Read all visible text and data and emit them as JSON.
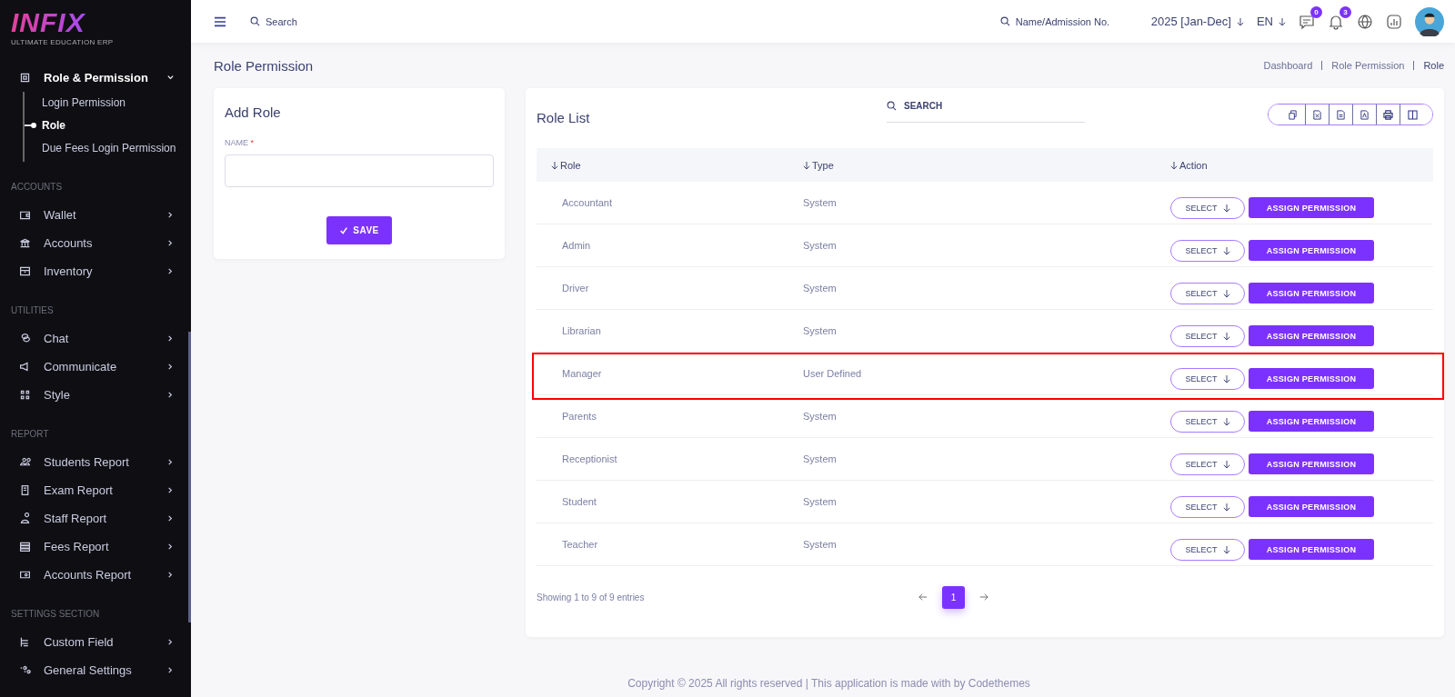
{
  "brand": {
    "logo": "INFIX",
    "tagline": "ULTIMATE EDUCATION ERP"
  },
  "sidebar": {
    "sections": [
      {
        "items": [
          {
            "label": "Role & Permission",
            "expanded": true,
            "children": [
              {
                "label": "Login Permission",
                "selected": false
              },
              {
                "label": "Role",
                "selected": true
              },
              {
                "label": "Due Fees Login Permission",
                "selected": false
              }
            ]
          }
        ]
      },
      {
        "heading": "ACCOUNTS",
        "items": [
          {
            "label": "Wallet",
            "expanded": false
          },
          {
            "label": "Accounts",
            "expanded": false
          },
          {
            "label": "Inventory",
            "expanded": false
          }
        ]
      },
      {
        "heading": "UTILITIES",
        "items": [
          {
            "label": "Chat",
            "expanded": false
          },
          {
            "label": "Communicate",
            "expanded": false
          },
          {
            "label": "Style",
            "expanded": false
          }
        ]
      },
      {
        "heading": "REPORT",
        "items": [
          {
            "label": "Students Report",
            "expanded": false
          },
          {
            "label": "Exam Report",
            "expanded": false
          },
          {
            "label": "Staff Report",
            "expanded": false
          },
          {
            "label": "Fees Report",
            "expanded": false
          },
          {
            "label": "Accounts Report",
            "expanded": false
          }
        ]
      },
      {
        "heading": "SETTINGS SECTION",
        "items": [
          {
            "label": "Custom Field",
            "expanded": false
          },
          {
            "label": "General Settings",
            "expanded": false
          }
        ]
      }
    ]
  },
  "header": {
    "search": {
      "placeholder": "Search"
    },
    "student_search": {
      "placeholder": "Name/Admission No."
    },
    "session": "2025 [Jan-Dec]",
    "language": "EN",
    "chat_count": "0",
    "notification_count": "3"
  },
  "page_title": "Role Permission",
  "breadcrumb": [
    "Dashboard",
    "Role Permission",
    "Role"
  ],
  "add_role": {
    "title": "Add Role",
    "field_label": "NAME",
    "required_mark": "*",
    "save": "SAVE"
  },
  "role_list": {
    "title": "Role List",
    "search": {
      "placeholder": "SEARCH"
    },
    "columns": [
      "Role",
      "Type",
      "Action"
    ],
    "rows": [
      {
        "role": "Accountant",
        "type": "System",
        "select": "SELECT",
        "assign": "ASSIGN PERMISSION",
        "highlighted": false
      },
      {
        "role": "Admin",
        "type": "System",
        "select": "SELECT",
        "assign": "ASSIGN PERMISSION",
        "highlighted": false
      },
      {
        "role": "Driver",
        "type": "System",
        "select": "SELECT",
        "assign": "ASSIGN PERMISSION",
        "highlighted": false
      },
      {
        "role": "Librarian",
        "type": "System",
        "select": "SELECT",
        "assign": "ASSIGN PERMISSION",
        "highlighted": false
      },
      {
        "role": "Manager",
        "type": "User Defined",
        "select": "SELECT",
        "assign": "ASSIGN PERMISSION",
        "highlighted": true
      },
      {
        "role": "Parents",
        "type": "System",
        "select": "SELECT",
        "assign": "ASSIGN PERMISSION",
        "highlighted": false
      },
      {
        "role": "Receptionist",
        "type": "System",
        "select": "SELECT",
        "assign": "ASSIGN PERMISSION",
        "highlighted": false
      },
      {
        "role": "Student",
        "type": "System",
        "select": "SELECT",
        "assign": "ASSIGN PERMISSION",
        "highlighted": false
      },
      {
        "role": "Teacher",
        "type": "System",
        "select": "SELECT",
        "assign": "ASSIGN PERMISSION",
        "highlighted": false
      }
    ],
    "info": "Showing 1 to 9 of 9 entries",
    "pages": [
      {
        "label": "1",
        "selected": true
      }
    ]
  },
  "footer": "Copyright © 2025 All rights reserved | This application is made with by Codethemes"
}
